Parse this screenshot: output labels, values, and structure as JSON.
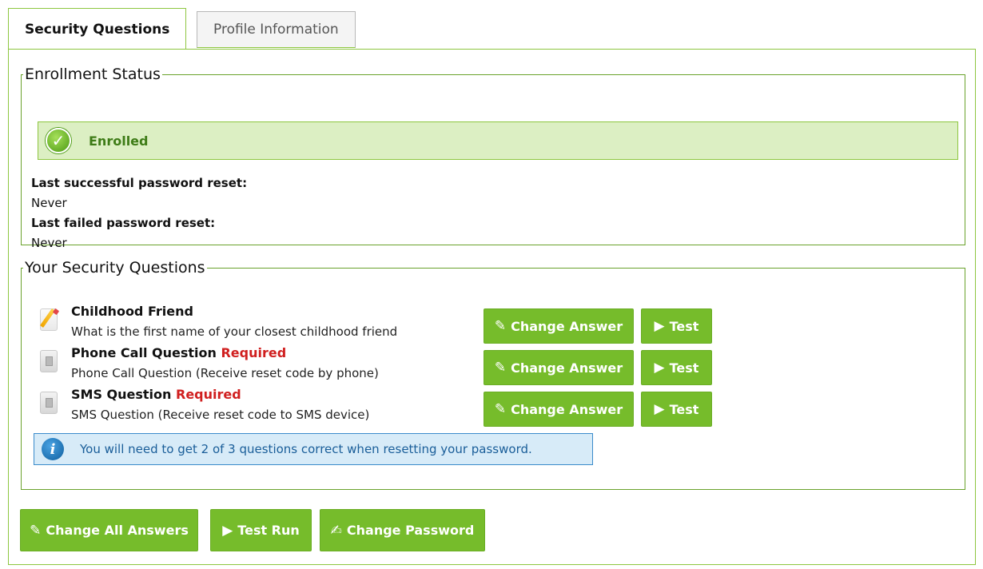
{
  "tabs": [
    {
      "label": "Security Questions",
      "active": true
    },
    {
      "label": "Profile Information",
      "active": false
    }
  ],
  "enrollment": {
    "legend": "Enrollment Status",
    "status": "Enrolled",
    "last_success_label": "Last successful password reset:",
    "last_success_value": "Never",
    "last_failed_label": "Last failed password reset:",
    "last_failed_value": "Never"
  },
  "questions_section": {
    "legend": "Your Security Questions",
    "questions": [
      {
        "title": "Childhood Friend",
        "required": "",
        "description": "What is the first name of your closest childhood friend",
        "icon": "note-pencil-icon"
      },
      {
        "title": "Phone Call Question",
        "required": "Required",
        "description": "Phone Call Question (Receive reset code by phone)",
        "icon": "phone-icon"
      },
      {
        "title": "SMS Question",
        "required": "Required",
        "description": "SMS Question (Receive reset code to SMS device)",
        "icon": "phone-icon"
      }
    ],
    "change_answer_label": "Change Answer",
    "test_label": "Test",
    "notice": "You will need to get 2 of 3 questions correct when resetting your password."
  },
  "footer": {
    "change_all_label": "Change All Answers",
    "test_run_label": "Test Run",
    "change_password_label": "Change Password"
  },
  "colors": {
    "accent": "#76bc2b",
    "required": "#d01f1f",
    "info": "#1a5e99"
  }
}
